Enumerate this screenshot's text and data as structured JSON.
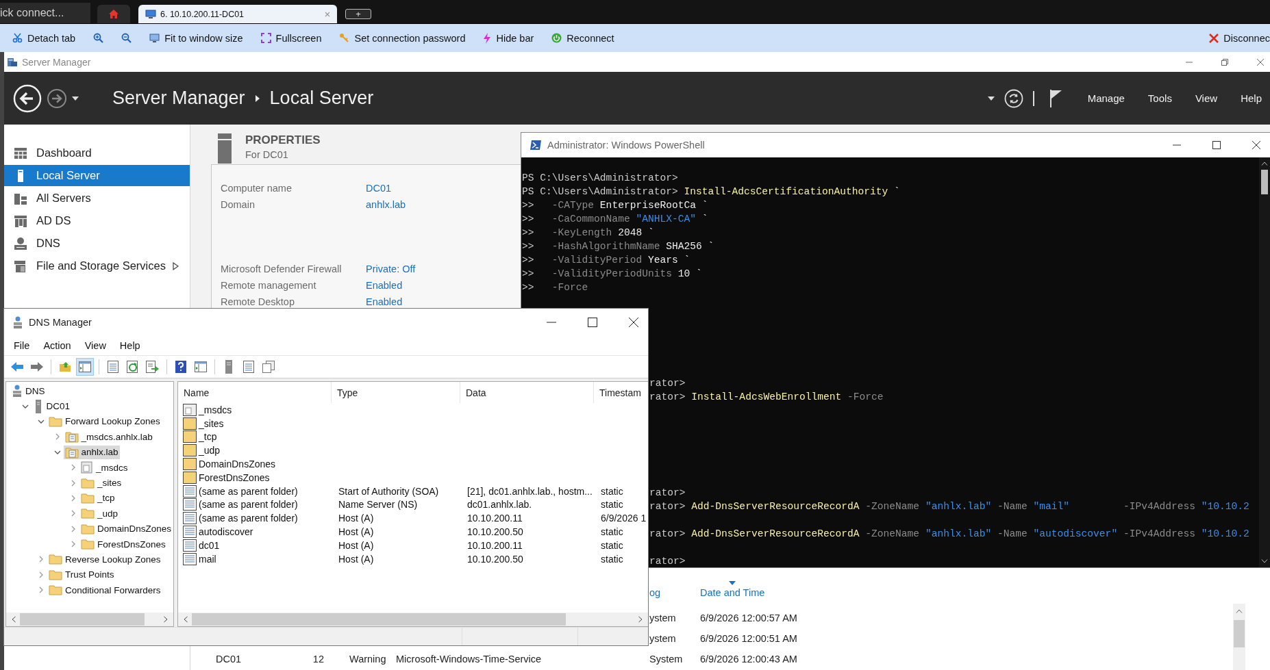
{
  "browser": {
    "quick_connect": "ick connect...",
    "tabs": [
      {
        "kind": "home",
        "selected": false
      },
      {
        "kind": "session",
        "label": "6. 10.10.200.11-DC01",
        "selected": true
      },
      {
        "kind": "new",
        "label": "+",
        "selected": false
      }
    ],
    "toolbar": [
      {
        "kind": "detach",
        "label": "Detach tab"
      },
      {
        "kind": "zoom-in"
      },
      {
        "kind": "zoom-out"
      },
      {
        "kind": "fit",
        "label": "Fit to window size"
      },
      {
        "kind": "fullscreen",
        "label": "Fullscreen"
      },
      {
        "kind": "password",
        "label": "Set connection password"
      },
      {
        "kind": "hide",
        "label": "Hide bar"
      },
      {
        "kind": "reconnect",
        "label": "Reconnect"
      },
      {
        "kind": "disconnect",
        "label": "Disconnec"
      }
    ]
  },
  "server_manager": {
    "window_title": "Server Manager",
    "breadcrumb": [
      "Server Manager",
      "Local Server"
    ],
    "menu": [
      "Manage",
      "Tools",
      "View",
      "Help"
    ],
    "nav": [
      {
        "label": "Dashboard",
        "kind": "dashboard",
        "selected": false
      },
      {
        "label": "Local Server",
        "kind": "server",
        "selected": true
      },
      {
        "label": "All Servers",
        "kind": "servers",
        "selected": false
      },
      {
        "label": "AD DS",
        "kind": "role",
        "selected": false
      },
      {
        "label": "DNS",
        "kind": "dns",
        "selected": false
      },
      {
        "label": "File and Storage Services",
        "kind": "storage",
        "selected": false,
        "submenu": true
      }
    ],
    "properties": {
      "title": "PROPERTIES",
      "subtitle": "For DC01",
      "groups": [
        [
          {
            "label": "Computer name",
            "value": "DC01"
          },
          {
            "label": "Domain",
            "value": "anhlx.lab"
          }
        ],
        [
          {
            "label": "Microsoft Defender Firewall",
            "value": "Private: Off"
          },
          {
            "label": "Remote management",
            "value": "Enabled"
          },
          {
            "label": "Remote Desktop",
            "value": "Enabled"
          }
        ]
      ]
    },
    "events": {
      "header": {
        "log": {
          "label": "og",
          "sorted": false
        },
        "date": {
          "label": "Date and Time",
          "sorted": true
        }
      },
      "rows": [
        {
          "log": "ystem",
          "date": "6/9/2026 12:00:57 AM"
        },
        {
          "log": "ystem",
          "date": "6/9/2026 12:00:51 AM"
        },
        {
          "server": "DC01",
          "id": "12",
          "severity": "Warning",
          "source": "Microsoft-Windows-Time-Service",
          "log": "System",
          "date": "6/9/2026 12:00:43 AM"
        }
      ]
    }
  },
  "powershell": {
    "title": "Administrator: Windows PowerShell",
    "lines": [
      {
        "kind": "full",
        "segments": [
          {
            "kind": "prompt",
            "text": "PS C:\\Users\\Administrator>"
          }
        ]
      },
      {
        "kind": "full",
        "segments": [
          {
            "kind": "prompt",
            "text": "PS C:\\Users\\Administrator> "
          },
          {
            "kind": "command",
            "text": "Install-AdcsCertificationAuthority"
          },
          {
            "kind": "value",
            "text": " `"
          }
        ]
      },
      {
        "kind": "full",
        "segments": [
          {
            "kind": "prompt",
            "text": ">>   "
          },
          {
            "kind": "param",
            "text": "-CAType"
          },
          {
            "kind": "value",
            "text": " EnterpriseRootCa `"
          }
        ]
      },
      {
        "kind": "full",
        "segments": [
          {
            "kind": "prompt",
            "text": ">>   "
          },
          {
            "kind": "param",
            "text": "-CaCommonName "
          },
          {
            "kind": "string",
            "text": "\"ANHLX-CA\""
          },
          {
            "kind": "value",
            "text": " `"
          }
        ]
      },
      {
        "kind": "full",
        "segments": [
          {
            "kind": "prompt",
            "text": ">>   "
          },
          {
            "kind": "param",
            "text": "-KeyLength"
          },
          {
            "kind": "value",
            "text": " 2048 `"
          }
        ]
      },
      {
        "kind": "full",
        "segments": [
          {
            "kind": "prompt",
            "text": ">>   "
          },
          {
            "kind": "param",
            "text": "-HashAlgorithmName"
          },
          {
            "kind": "value",
            "text": " SHA256 `"
          }
        ]
      },
      {
        "kind": "full",
        "segments": [
          {
            "kind": "prompt",
            "text": ">>   "
          },
          {
            "kind": "param",
            "text": "-ValidityPeriod"
          },
          {
            "kind": "value",
            "text": " Years `"
          }
        ]
      },
      {
        "kind": "full",
        "segments": [
          {
            "kind": "prompt",
            "text": ">>   "
          },
          {
            "kind": "param",
            "text": "-ValidityPeriodUnits"
          },
          {
            "kind": "value",
            "text": " 10 `"
          }
        ]
      },
      {
        "kind": "full",
        "segments": [
          {
            "kind": "prompt",
            "text": ">>   "
          },
          {
            "kind": "param",
            "text": "-Force"
          }
        ]
      },
      {
        "kind": "blank"
      },
      {
        "kind": "blank"
      },
      {
        "kind": "blank"
      },
      {
        "kind": "blank"
      },
      {
        "kind": "blank"
      },
      {
        "kind": "blank"
      },
      {
        "kind": "partial",
        "segments": [
          {
            "kind": "prompt",
            "text": "rator>"
          }
        ]
      },
      {
        "kind": "partial",
        "segments": [
          {
            "kind": "prompt",
            "text": "rator> "
          },
          {
            "kind": "command",
            "text": "Install-AdcsWebEnrollment"
          },
          {
            "kind": "param",
            "text": " -Force"
          }
        ]
      },
      {
        "kind": "blank"
      },
      {
        "kind": "blank"
      },
      {
        "kind": "blank"
      },
      {
        "kind": "blank"
      },
      {
        "kind": "blank"
      },
      {
        "kind": "blank"
      },
      {
        "kind": "partial",
        "segments": [
          {
            "kind": "prompt",
            "text": "rator>"
          }
        ]
      },
      {
        "kind": "partial",
        "segments": [
          {
            "kind": "prompt",
            "text": "rator> "
          },
          {
            "kind": "command",
            "text": "Add-DnsServerResourceRecordA"
          },
          {
            "kind": "param",
            "text": " -ZoneName "
          },
          {
            "kind": "string",
            "text": "\"anhlx.lab\""
          },
          {
            "kind": "param",
            "text": " -Name "
          },
          {
            "kind": "string",
            "text": "\"mail\""
          },
          {
            "kind": "param",
            "text": "         -IPv4Address "
          },
          {
            "kind": "string",
            "text": "\"10.10.2"
          }
        ]
      },
      {
        "kind": "blank"
      },
      {
        "kind": "partial",
        "segments": [
          {
            "kind": "prompt",
            "text": "rator> "
          },
          {
            "kind": "command",
            "text": "Add-DnsServerResourceRecordA"
          },
          {
            "kind": "param",
            "text": " -ZoneName "
          },
          {
            "kind": "string",
            "text": "\"anhlx.lab\""
          },
          {
            "kind": "param",
            "text": " -Name "
          },
          {
            "kind": "string",
            "text": "\"autodiscover\""
          },
          {
            "kind": "param",
            "text": " -IPv4Address "
          },
          {
            "kind": "string",
            "text": "\"10.10.2"
          }
        ]
      },
      {
        "kind": "blank"
      },
      {
        "kind": "partial",
        "segments": [
          {
            "kind": "prompt",
            "text": "rator>"
          }
        ]
      }
    ]
  },
  "dns": {
    "title": "DNS Manager",
    "menu": [
      "File",
      "Action",
      "View",
      "Help"
    ],
    "toolbar": [
      {
        "kind": "back",
        "pressed": false
      },
      {
        "kind": "forward",
        "pressed": false
      },
      {
        "kind": "separator"
      },
      {
        "kind": "up",
        "pressed": false
      },
      {
        "kind": "tree",
        "pressed": true
      },
      {
        "kind": "separator"
      },
      {
        "kind": "properties",
        "pressed": false
      },
      {
        "kind": "refresh",
        "pressed": false
      },
      {
        "kind": "export",
        "pressed": false
      },
      {
        "kind": "separator"
      },
      {
        "kind": "help",
        "pressed": false
      },
      {
        "kind": "action",
        "pressed": false
      },
      {
        "kind": "separator"
      },
      {
        "kind": "server",
        "pressed": false
      },
      {
        "kind": "list",
        "pressed": false
      },
      {
        "kind": "copy",
        "pressed": false
      }
    ],
    "tree": [
      {
        "label": "DNS",
        "kind": "root",
        "selected": false,
        "children": [
          {
            "label": "DC01",
            "kind": "server",
            "expanded": true,
            "selected": false,
            "children": [
              {
                "label": "Forward Lookup Zones",
                "kind": "folder",
                "expanded": true,
                "selected": false,
                "children": [
                  {
                    "label": "_msdcs.anhlx.lab",
                    "kind": "zone",
                    "expanded": false,
                    "selected": false
                  },
                  {
                    "label": "anhlx.lab",
                    "kind": "zone",
                    "expanded": true,
                    "selected": true,
                    "children": [
                      {
                        "label": "_msdcs",
                        "kind": "delegation",
                        "expanded": false,
                        "selected": false
                      },
                      {
                        "label": "_sites",
                        "kind": "folder",
                        "expanded": false,
                        "selected": false
                      },
                      {
                        "label": "_tcp",
                        "kind": "folder",
                        "expanded": false,
                        "selected": false
                      },
                      {
                        "label": "_udp",
                        "kind": "folder",
                        "expanded": false,
                        "selected": false
                      },
                      {
                        "label": "DomainDnsZones",
                        "kind": "folder",
                        "expanded": false,
                        "selected": false
                      },
                      {
                        "label": "ForestDnsZones",
                        "kind": "folder",
                        "expanded": false,
                        "selected": false
                      }
                    ]
                  }
                ]
              },
              {
                "label": "Reverse Lookup Zones",
                "kind": "folder",
                "expanded": false,
                "selected": false
              },
              {
                "label": "Trust Points",
                "kind": "folder",
                "expanded": false,
                "selected": false
              },
              {
                "label": "Conditional Forwarders",
                "kind": "folder",
                "expanded": false,
                "selected": false
              }
            ]
          }
        ]
      }
    ],
    "columns": [
      "Name",
      "Type",
      "Data",
      "Timestam"
    ],
    "rows": [
      {
        "kind": "delegation",
        "name": "_msdcs"
      },
      {
        "kind": "folder",
        "name": "_sites"
      },
      {
        "kind": "folder",
        "name": "_tcp"
      },
      {
        "kind": "folder",
        "name": "_udp"
      },
      {
        "kind": "folder",
        "name": "DomainDnsZones"
      },
      {
        "kind": "folder",
        "name": "ForestDnsZones"
      },
      {
        "kind": "record",
        "name": "(same as parent folder)",
        "type": "Start of Authority (SOA)",
        "data": "[21], dc01.anhlx.lab., hostm...",
        "timestamp": "static"
      },
      {
        "kind": "record",
        "name": "(same as parent folder)",
        "type": "Name Server (NS)",
        "data": "dc01.anhlx.lab.",
        "timestamp": "static"
      },
      {
        "kind": "record",
        "name": "(same as parent folder)",
        "type": "Host (A)",
        "data": "10.10.200.11",
        "timestamp": "6/9/2026 1"
      },
      {
        "kind": "record",
        "name": "autodiscover",
        "type": "Host (A)",
        "data": "10.10.200.50",
        "timestamp": "static"
      },
      {
        "kind": "record",
        "name": "dc01",
        "type": "Host (A)",
        "data": "10.10.200.11",
        "timestamp": "static"
      },
      {
        "kind": "record",
        "name": "mail",
        "type": "Host (A)",
        "data": "10.10.200.50",
        "timestamp": "static"
      }
    ]
  }
}
